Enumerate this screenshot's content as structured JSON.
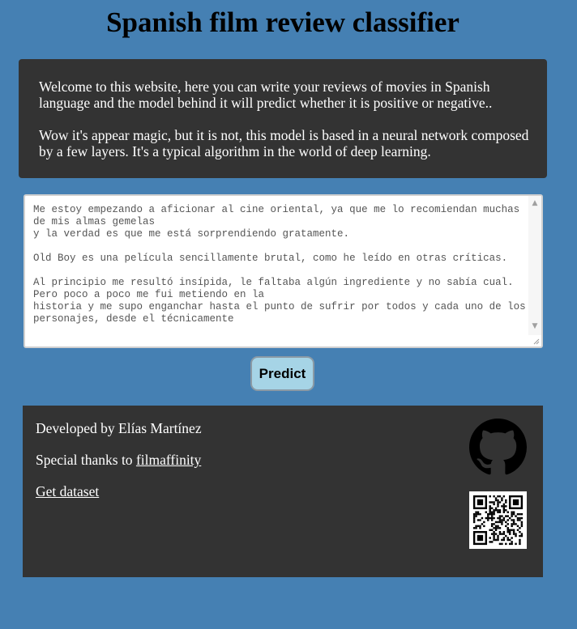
{
  "page": {
    "title": "Spanish film review classifier"
  },
  "intro": {
    "paragraph1": "Welcome to this website, here you can write your reviews of movies in Spanish language and the model behind it will predict whether it is positive or negative..",
    "paragraph2": "Wow it's appear magic, but it is not, this model is based in a neural network composed by a few layers. It's a typical algorithm in the world of deep learning."
  },
  "review": {
    "value": "Me estoy empezando a aficionar al cine oriental, ya que me lo recomiendan muchas de mis almas gemelas\ny la verdad es que me está sorprendiendo gratamente.\n\nOld Boy es una película sencillamente brutal, como he leído en otras críticas.\n\nAl principio me resultó insípida, le faltaba algún ingrediente y no sabía cual. Pero poco a poco me fui metiendo en la\nhistoria y me supo enganchar hasta el punto de sufrir por todos y cada uno de los personajes, desde el técnicamente"
  },
  "predict_button": {
    "label": "Predict"
  },
  "footer": {
    "developed_by": "Developed by Elías Martínez",
    "thanks_prefix": "Special thanks to ",
    "thanks_link": "filmaffinity",
    "dataset_link": "Get dataset",
    "github_icon": "github-icon",
    "qr_icon": "qr-code-icon"
  },
  "colors": {
    "background": "#4580b3",
    "panel": "#333333",
    "button": "#a6d4e6"
  }
}
